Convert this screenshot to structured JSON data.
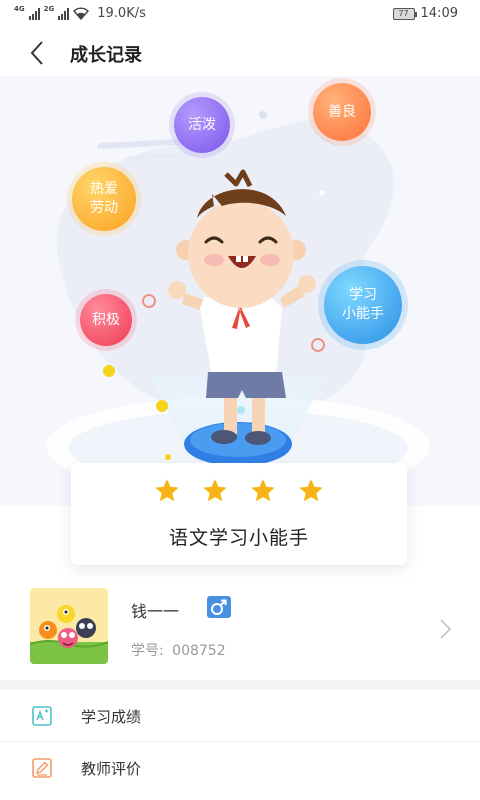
{
  "status_bar": {
    "net1": "4G",
    "net2": "2G",
    "speed": "19.0K/s",
    "battery": "77",
    "time": "14:09"
  },
  "nav": {
    "title": "成长记录"
  },
  "bubbles": {
    "lively": "活泼",
    "kind": "善良",
    "labor_l1": "热爱",
    "labor_l2": "劳动",
    "active": "积极",
    "learn_l1": "学习",
    "learn_l2": "小能手"
  },
  "badge": {
    "stars": 4,
    "title": "语文学习小能手"
  },
  "student": {
    "name": "钱一一",
    "gender_symbol": "♂",
    "id_label": "学号:",
    "id_value": "008752"
  },
  "menu": {
    "items": [
      {
        "label": "学习成绩",
        "icon": "grade-icon"
      },
      {
        "label": "教师评价",
        "icon": "teacher-review-icon"
      }
    ]
  },
  "colors": {
    "accent_blue": "#4a90e2",
    "star_gold": "#f7b515",
    "bubble_purple": "#8f6ef2",
    "bubble_orange": "#ff8a50",
    "bubble_yellow": "#fdb72e",
    "bubble_red": "#f5495e",
    "bubble_cyan": "#37a8ef"
  }
}
